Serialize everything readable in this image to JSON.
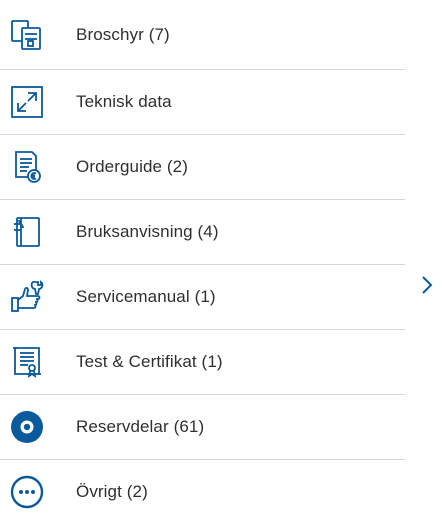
{
  "menu": {
    "items": [
      {
        "label": "Broschyr (7)",
        "icon": "brochure-icon"
      },
      {
        "label": "Teknisk data",
        "icon": "expand-arrows-icon"
      },
      {
        "label": "Orderguide (2)",
        "icon": "price-document-icon"
      },
      {
        "label": "Bruksanvisning (4)",
        "icon": "manual-book-icon"
      },
      {
        "label": "Servicemanual (1)",
        "icon": "wrench-hand-icon"
      },
      {
        "label": "Test & Certifikat (1)",
        "icon": "certificate-icon"
      },
      {
        "label": "Reservdelar (61)",
        "icon": "spare-parts-icon"
      },
      {
        "label": "Övrigt (2)",
        "icon": "more-dots-icon"
      }
    ]
  },
  "colors": {
    "icon_blue": "#0a5a9c",
    "divider": "#d6d6d6",
    "text": "#2f2f2f"
  },
  "chevron_icon": "chevron-right-icon"
}
